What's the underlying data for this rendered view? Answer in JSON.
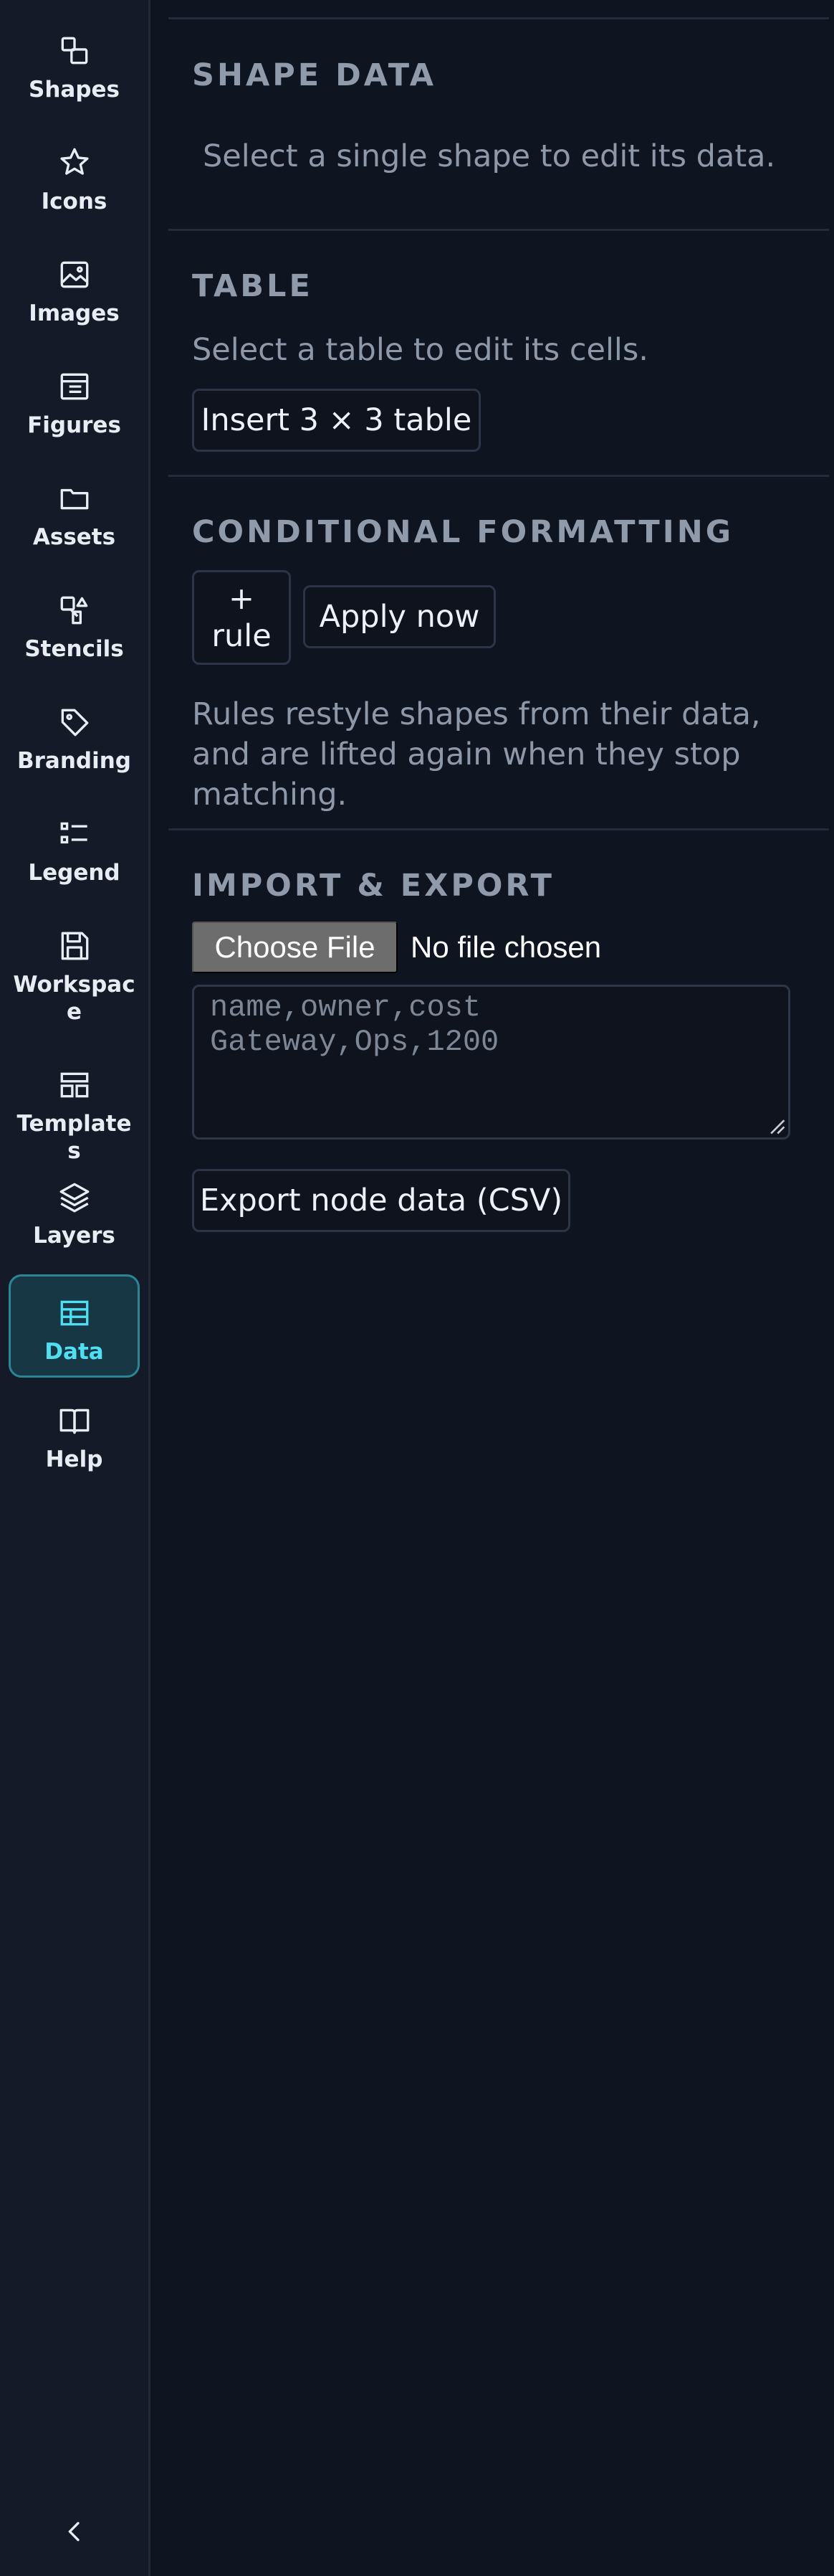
{
  "sidebar": {
    "items": [
      {
        "label": "Shapes",
        "icon": "shapes-icon"
      },
      {
        "label": "Icons",
        "icon": "star-icon"
      },
      {
        "label": "Images",
        "icon": "image-icon"
      },
      {
        "label": "Figures",
        "icon": "figure-icon"
      },
      {
        "label": "Assets",
        "icon": "folder-icon"
      },
      {
        "label": "Stencils",
        "icon": "stencil-icon"
      },
      {
        "label": "Branding",
        "icon": "tag-icon"
      },
      {
        "label": "Legend",
        "icon": "list-icon"
      },
      {
        "label": "Workspace",
        "icon": "save-icon"
      },
      {
        "label": "Templates",
        "icon": "layout-icon"
      },
      {
        "label": "Layers",
        "icon": "layers-icon"
      },
      {
        "label": "Data",
        "icon": "table-icon",
        "active": true
      },
      {
        "label": "Help",
        "icon": "book-icon"
      }
    ],
    "collapse_icon": "chevron-left-icon"
  },
  "shape_data": {
    "title": "SHAPE DATA",
    "hint": "Select a single shape to edit its data."
  },
  "table": {
    "title": "TABLE",
    "hint": "Select a table to edit its cells.",
    "insert_label": "Insert 3 × 3 table"
  },
  "conditional": {
    "title": "CONDITIONAL FORMATTING",
    "add_rule_label": "+ rule",
    "apply_label": "Apply now",
    "hint": "Rules restyle shapes from their data, and are lifted again when they stop matching."
  },
  "import_export": {
    "title": "IMPORT & EXPORT",
    "file_button": "Choose File",
    "file_status": "No file chosen",
    "csv_placeholder": "name,owner,cost\nGateway,Ops,1200",
    "export_label": "Export node data (CSV)"
  },
  "colors": {
    "background": "#0f1421",
    "rail": "#141a28",
    "accent": "#4ee0f2",
    "active_bg": "#173745"
  }
}
